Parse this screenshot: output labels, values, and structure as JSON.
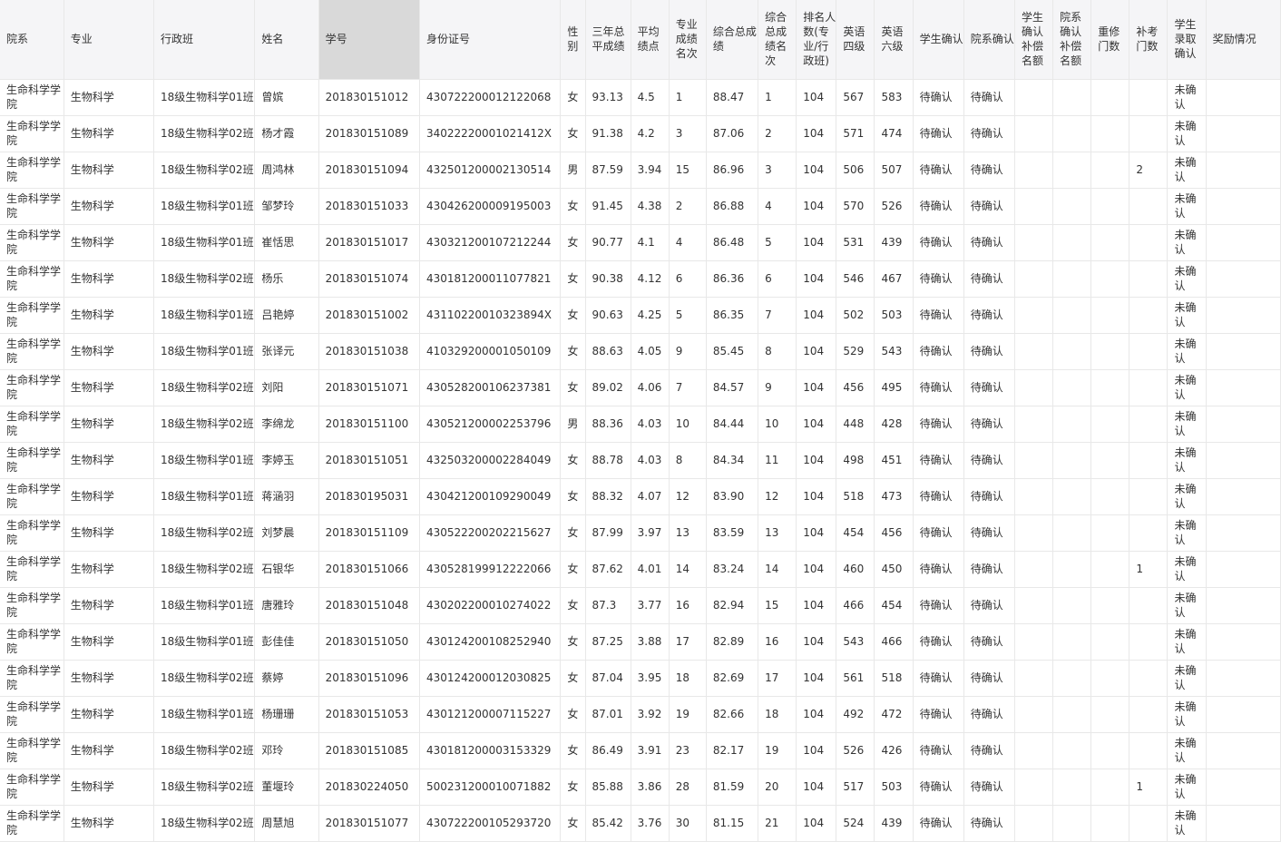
{
  "table": {
    "headers": [
      "院系",
      "专业",
      "行政班",
      "姓名",
      "学号",
      "身份证号",
      "性别",
      "三年总平成绩",
      "平均绩点",
      "专业成绩名次",
      "综合总成绩",
      "综合总成绩名次",
      "排名人数(专业/行政班)",
      "英语四级",
      "英语六级",
      "学生确认",
      "院系确认",
      "学生确认补偿名额",
      "院系确认补偿名额",
      "重修门数",
      "补考门数",
      "学生录取确认",
      "奖励情况"
    ],
    "rows": [
      [
        "生命科学学院",
        "生物科学",
        "18级生物科学01班",
        "曾嫔",
        "201830151012",
        "430722200012122068",
        "女",
        "93.13",
        "4.5",
        "1",
        "88.47",
        "1",
        "104",
        "567",
        "583",
        "待确认",
        "待确认",
        "",
        "",
        "",
        "",
        "未确认",
        ""
      ],
      [
        "生命科学学院",
        "生物科学",
        "18级生物科学02班",
        "杨才霞",
        "201830151089",
        "34022220001021412X",
        "女",
        "91.38",
        "4.2",
        "3",
        "87.06",
        "2",
        "104",
        "571",
        "474",
        "待确认",
        "待确认",
        "",
        "",
        "",
        "",
        "未确认",
        ""
      ],
      [
        "生命科学学院",
        "生物科学",
        "18级生物科学02班",
        "周鸿林",
        "201830151094",
        "432501200002130514",
        "男",
        "87.59",
        "3.94",
        "15",
        "86.96",
        "3",
        "104",
        "506",
        "507",
        "待确认",
        "待确认",
        "",
        "",
        "",
        "2",
        "未确认",
        ""
      ],
      [
        "生命科学学院",
        "生物科学",
        "18级生物科学01班",
        "邹梦玲",
        "201830151033",
        "430426200009195003",
        "女",
        "91.45",
        "4.38",
        "2",
        "86.88",
        "4",
        "104",
        "570",
        "526",
        "待确认",
        "待确认",
        "",
        "",
        "",
        "",
        "未确认",
        ""
      ],
      [
        "生命科学学院",
        "生物科学",
        "18级生物科学01班",
        "崔恬思",
        "201830151017",
        "430321200107212244",
        "女",
        "90.77",
        "4.1",
        "4",
        "86.48",
        "5",
        "104",
        "531",
        "439",
        "待确认",
        "待确认",
        "",
        "",
        "",
        "",
        "未确认",
        ""
      ],
      [
        "生命科学学院",
        "生物科学",
        "18级生物科学02班",
        "杨乐",
        "201830151074",
        "430181200011077821",
        "女",
        "90.38",
        "4.12",
        "6",
        "86.36",
        "6",
        "104",
        "546",
        "467",
        "待确认",
        "待确认",
        "",
        "",
        "",
        "",
        "未确认",
        ""
      ],
      [
        "生命科学学院",
        "生物科学",
        "18级生物科学01班",
        "吕艳婷",
        "201830151002",
        "43110220010323894X",
        "女",
        "90.63",
        "4.25",
        "5",
        "86.35",
        "7",
        "104",
        "502",
        "503",
        "待确认",
        "待确认",
        "",
        "",
        "",
        "",
        "未确认",
        ""
      ],
      [
        "生命科学学院",
        "生物科学",
        "18级生物科学01班",
        "张译元",
        "201830151038",
        "410329200001050109",
        "女",
        "88.63",
        "4.05",
        "9",
        "85.45",
        "8",
        "104",
        "529",
        "543",
        "待确认",
        "待确认",
        "",
        "",
        "",
        "",
        "未确认",
        ""
      ],
      [
        "生命科学学院",
        "生物科学",
        "18级生物科学02班",
        "刘阳",
        "201830151071",
        "430528200106237381",
        "女",
        "89.02",
        "4.06",
        "7",
        "84.57",
        "9",
        "104",
        "456",
        "495",
        "待确认",
        "待确认",
        "",
        "",
        "",
        "",
        "未确认",
        ""
      ],
      [
        "生命科学学院",
        "生物科学",
        "18级生物科学02班",
        "李绵龙",
        "201830151100",
        "430521200002253796",
        "男",
        "88.36",
        "4.03",
        "10",
        "84.44",
        "10",
        "104",
        "448",
        "428",
        "待确认",
        "待确认",
        "",
        "",
        "",
        "",
        "未确认",
        ""
      ],
      [
        "生命科学学院",
        "生物科学",
        "18级生物科学01班",
        "李婷玉",
        "201830151051",
        "432503200002284049",
        "女",
        "88.78",
        "4.03",
        "8",
        "84.34",
        "11",
        "104",
        "498",
        "451",
        "待确认",
        "待确认",
        "",
        "",
        "",
        "",
        "未确认",
        ""
      ],
      [
        "生命科学学院",
        "生物科学",
        "18级生物科学01班",
        "蒋涵羽",
        "201830195031",
        "430421200109290049",
        "女",
        "88.32",
        "4.07",
        "12",
        "83.90",
        "12",
        "104",
        "518",
        "473",
        "待确认",
        "待确认",
        "",
        "",
        "",
        "",
        "未确认",
        ""
      ],
      [
        "生命科学学院",
        "生物科学",
        "18级生物科学02班",
        "刘梦晨",
        "201830151109",
        "430522200202215627",
        "女",
        "87.99",
        "3.97",
        "13",
        "83.59",
        "13",
        "104",
        "454",
        "456",
        "待确认",
        "待确认",
        "",
        "",
        "",
        "",
        "未确认",
        ""
      ],
      [
        "生命科学学院",
        "生物科学",
        "18级生物科学02班",
        "石银华",
        "201830151066",
        "430528199912222066",
        "女",
        "87.62",
        "4.01",
        "14",
        "83.24",
        "14",
        "104",
        "460",
        "450",
        "待确认",
        "待确认",
        "",
        "",
        "",
        "1",
        "未确认",
        ""
      ],
      [
        "生命科学学院",
        "生物科学",
        "18级生物科学01班",
        "唐雅玲",
        "201830151048",
        "430202200010274022",
        "女",
        "87.3",
        "3.77",
        "16",
        "82.94",
        "15",
        "104",
        "466",
        "454",
        "待确认",
        "待确认",
        "",
        "",
        "",
        "",
        "未确认",
        ""
      ],
      [
        "生命科学学院",
        "生物科学",
        "18级生物科学01班",
        "彭佳佳",
        "201830151050",
        "430124200108252940",
        "女",
        "87.25",
        "3.88",
        "17",
        "82.89",
        "16",
        "104",
        "543",
        "466",
        "待确认",
        "待确认",
        "",
        "",
        "",
        "",
        "未确认",
        ""
      ],
      [
        "生命科学学院",
        "生物科学",
        "18级生物科学02班",
        "蔡婷",
        "201830151096",
        "430124200012030825",
        "女",
        "87.04",
        "3.95",
        "18",
        "82.69",
        "17",
        "104",
        "561",
        "518",
        "待确认",
        "待确认",
        "",
        "",
        "",
        "",
        "未确认",
        ""
      ],
      [
        "生命科学学院",
        "生物科学",
        "18级生物科学01班",
        "杨珊珊",
        "201830151053",
        "430121200007115227",
        "女",
        "87.01",
        "3.92",
        "19",
        "82.66",
        "18",
        "104",
        "492",
        "472",
        "待确认",
        "待确认",
        "",
        "",
        "",
        "",
        "未确认",
        ""
      ],
      [
        "生命科学学院",
        "生物科学",
        "18级生物科学02班",
        "邓玲",
        "201830151085",
        "430181200003153329",
        "女",
        "86.49",
        "3.91",
        "23",
        "82.17",
        "19",
        "104",
        "526",
        "426",
        "待确认",
        "待确认",
        "",
        "",
        "",
        "",
        "未确认",
        ""
      ],
      [
        "生命科学学院",
        "生物科学",
        "18级生物科学02班",
        "董堰玲",
        "201830224050",
        "500231200010071882",
        "女",
        "85.88",
        "3.86",
        "28",
        "81.59",
        "20",
        "104",
        "517",
        "503",
        "待确认",
        "待确认",
        "",
        "",
        "",
        "1",
        "未确认",
        ""
      ],
      [
        "生命科学学院",
        "生物科学",
        "18级生物科学02班",
        "周慧旭",
        "201830151077",
        "430722200105293720",
        "女",
        "85.42",
        "3.76",
        "30",
        "81.15",
        "21",
        "104",
        "524",
        "439",
        "待确认",
        "待确认",
        "",
        "",
        "",
        "",
        "未确认",
        ""
      ]
    ]
  },
  "colors": {
    "header_bg": "#f5f5f7",
    "sorted_header_bg": "#d9d9d9",
    "grid_line": "#e8e8e8",
    "text": "#333333"
  }
}
